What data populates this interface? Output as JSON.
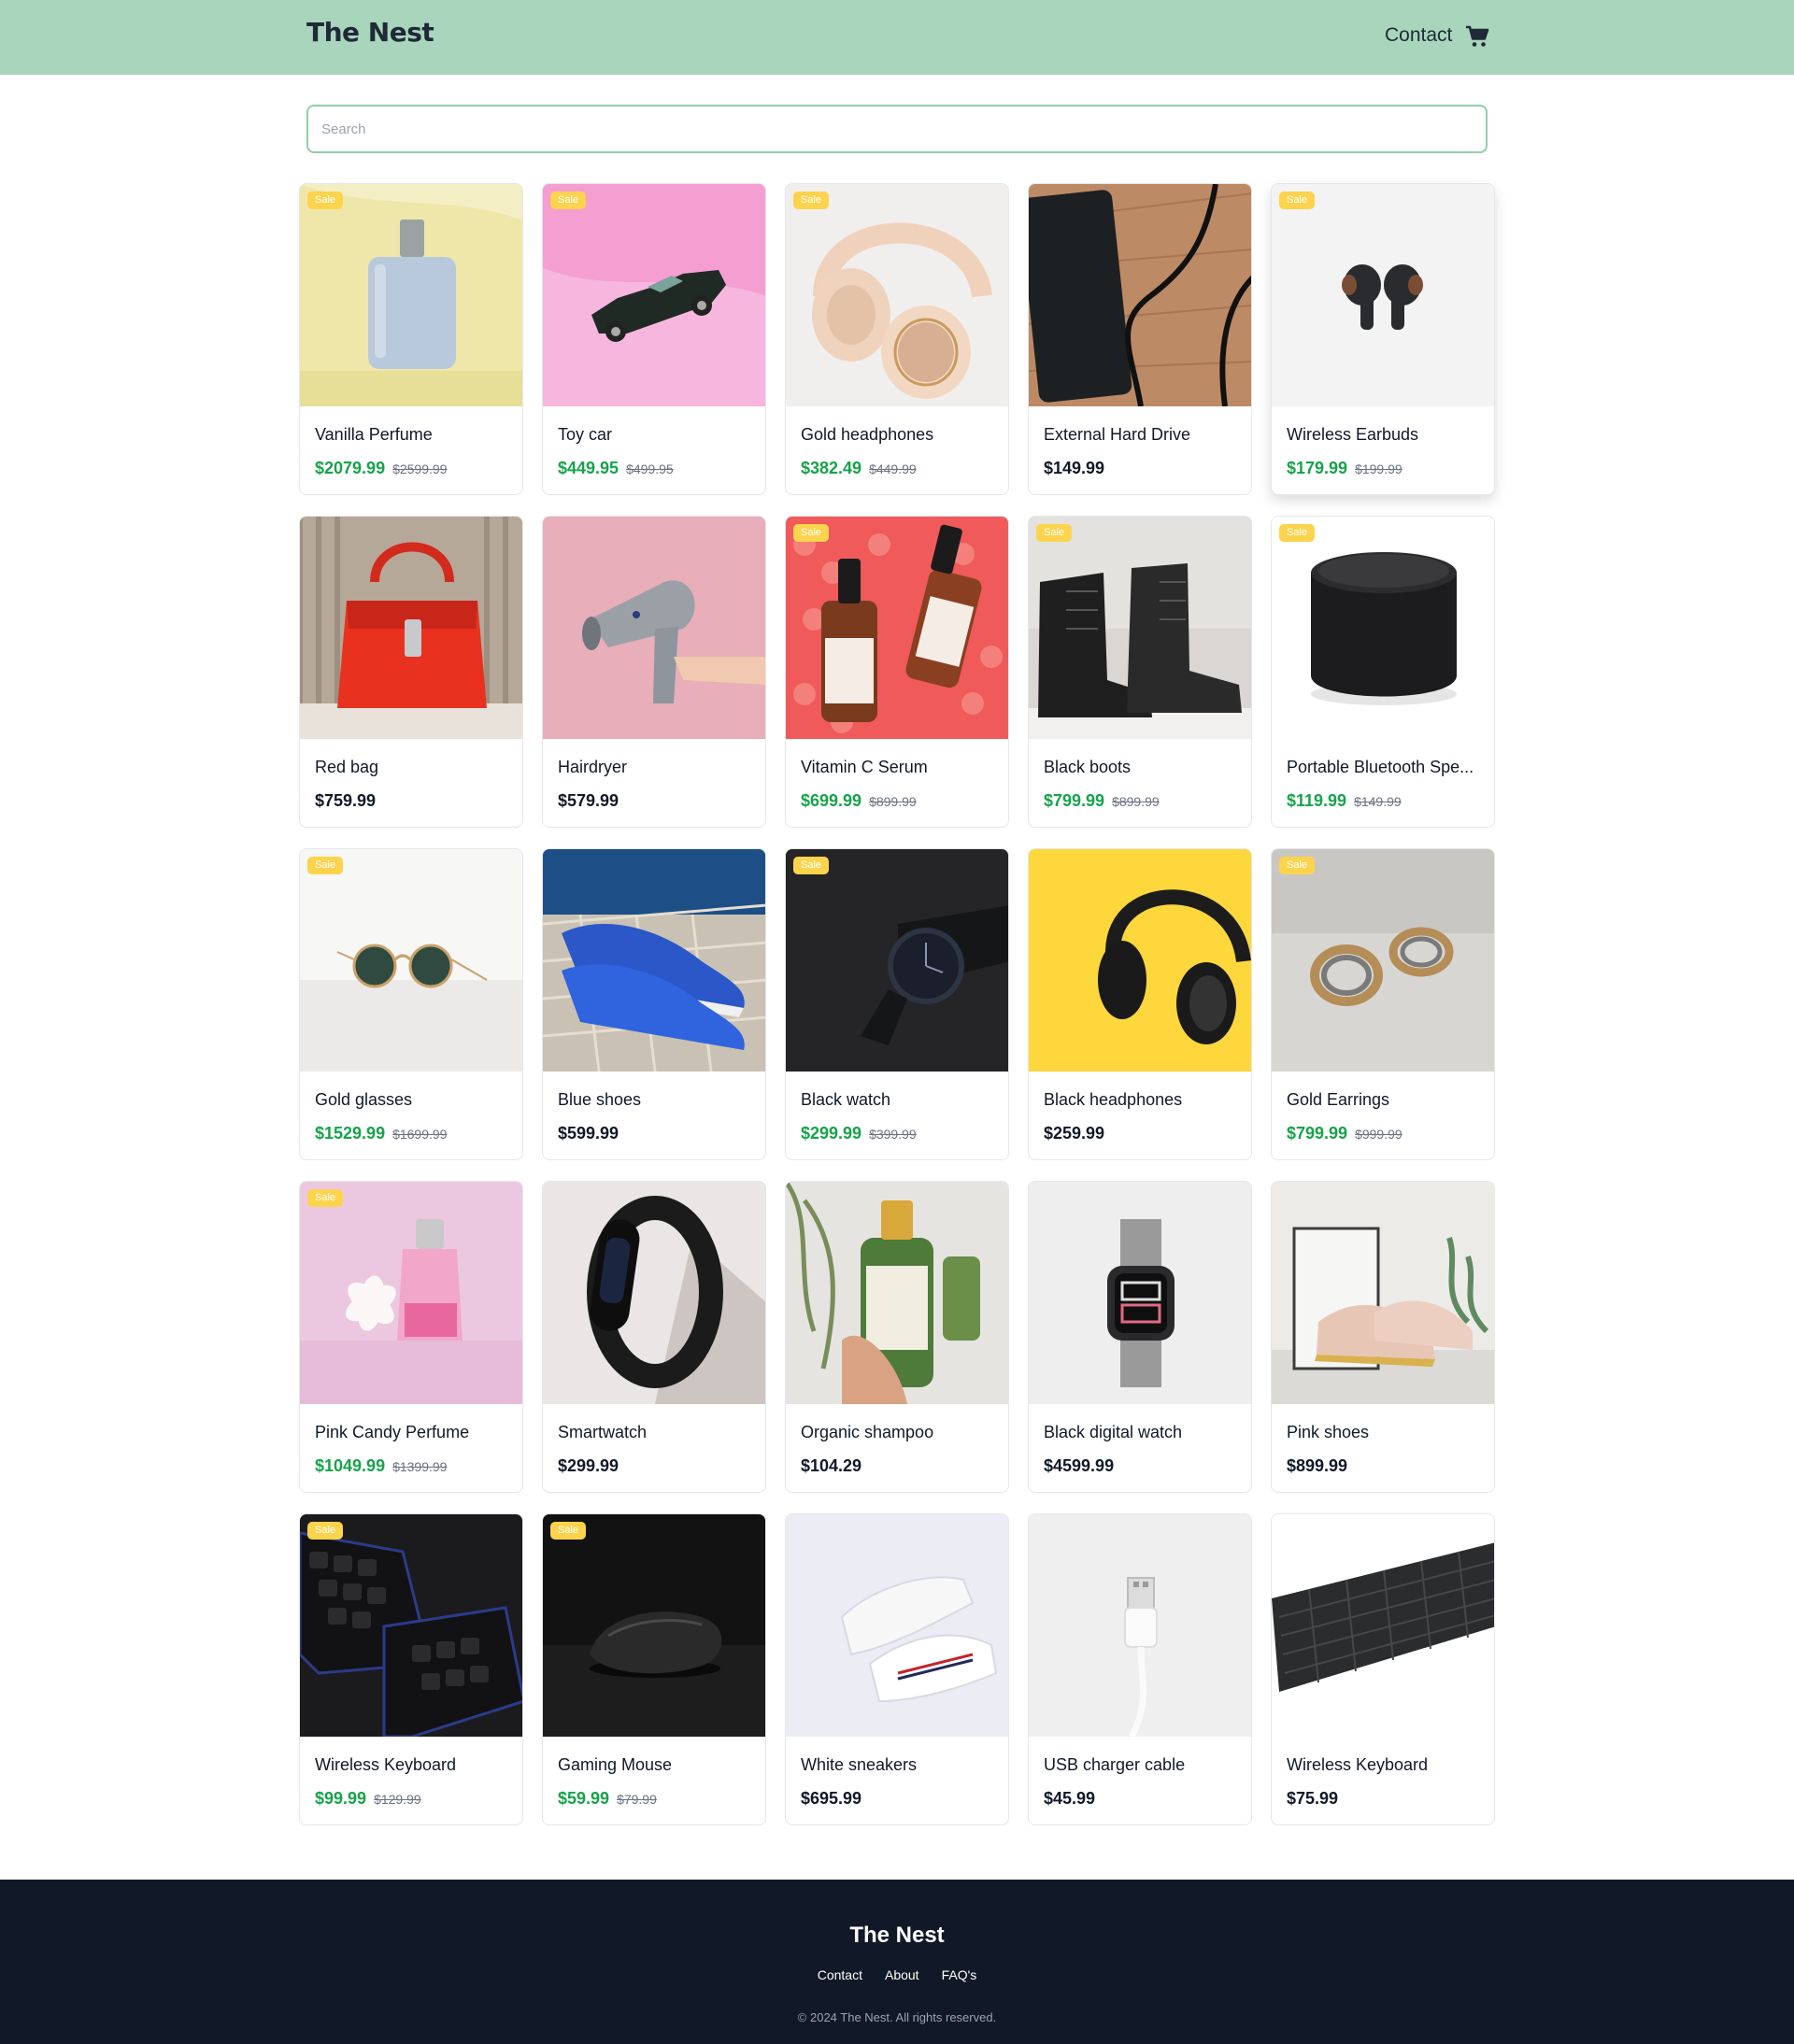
{
  "header": {
    "logo": "The Nest",
    "contact": "Contact",
    "cart_icon": "shopping-cart-icon"
  },
  "search": {
    "placeholder": "Search",
    "value": ""
  },
  "sale_badge": "Sale",
  "products": [
    {
      "name": "Vanilla Perfume",
      "price": "$2079.99",
      "old_price": "$2599.99",
      "sale": true
    },
    {
      "name": "Toy car",
      "price": "$449.95",
      "old_price": "$499.95",
      "sale": true
    },
    {
      "name": "Gold headphones",
      "price": "$382.49",
      "old_price": "$449.99",
      "sale": true
    },
    {
      "name": "External Hard Drive",
      "price": "$149.99",
      "old_price": "",
      "sale": false
    },
    {
      "name": "Wireless Earbuds",
      "price": "$179.99",
      "old_price": "$199.99",
      "sale": true
    },
    {
      "name": "Red bag",
      "price": "$759.99",
      "old_price": "",
      "sale": false
    },
    {
      "name": "Hairdryer",
      "price": "$579.99",
      "old_price": "",
      "sale": false
    },
    {
      "name": "Vitamin C Serum",
      "price": "$699.99",
      "old_price": "$899.99",
      "sale": true
    },
    {
      "name": "Black boots",
      "price": "$799.99",
      "old_price": "$899.99",
      "sale": true
    },
    {
      "name": "Portable Bluetooth Spe...",
      "price": "$119.99",
      "old_price": "$149.99",
      "sale": true
    },
    {
      "name": "Gold glasses",
      "price": "$1529.99",
      "old_price": "$1699.99",
      "sale": true
    },
    {
      "name": "Blue shoes",
      "price": "$599.99",
      "old_price": "",
      "sale": false
    },
    {
      "name": "Black watch",
      "price": "$299.99",
      "old_price": "$399.99",
      "sale": true
    },
    {
      "name": "Black headphones",
      "price": "$259.99",
      "old_price": "",
      "sale": false
    },
    {
      "name": "Gold Earrings",
      "price": "$799.99",
      "old_price": "$999.99",
      "sale": true
    },
    {
      "name": "Pink Candy Perfume",
      "price": "$1049.99",
      "old_price": "$1399.99",
      "sale": true
    },
    {
      "name": "Smartwatch",
      "price": "$299.99",
      "old_price": "",
      "sale": false
    },
    {
      "name": "Organic shampoo",
      "price": "$104.29",
      "old_price": "",
      "sale": false
    },
    {
      "name": "Black digital watch",
      "price": "$4599.99",
      "old_price": "",
      "sale": false
    },
    {
      "name": "Pink shoes",
      "price": "$899.99",
      "old_price": "",
      "sale": false
    },
    {
      "name": "Wireless Keyboard",
      "price": "$99.99",
      "old_price": "$129.99",
      "sale": true
    },
    {
      "name": "Gaming Mouse",
      "price": "$59.99",
      "old_price": "$79.99",
      "sale": true
    },
    {
      "name": "White sneakers",
      "price": "$695.99",
      "old_price": "",
      "sale": false
    },
    {
      "name": "USB charger cable",
      "price": "$45.99",
      "old_price": "",
      "sale": false
    },
    {
      "name": "Wireless Keyboard",
      "price": "$75.99",
      "old_price": "",
      "sale": false
    }
  ],
  "footer": {
    "title": "The Nest",
    "links": [
      "Contact",
      "About",
      "FAQ's"
    ],
    "copyright": "© 2024 The Nest. All rights reserved."
  },
  "colors": {
    "header_bg": "#a8d5bb",
    "sale_price": "#16a34a",
    "badge": "#fcd34d",
    "footer_bg": "#111827"
  }
}
